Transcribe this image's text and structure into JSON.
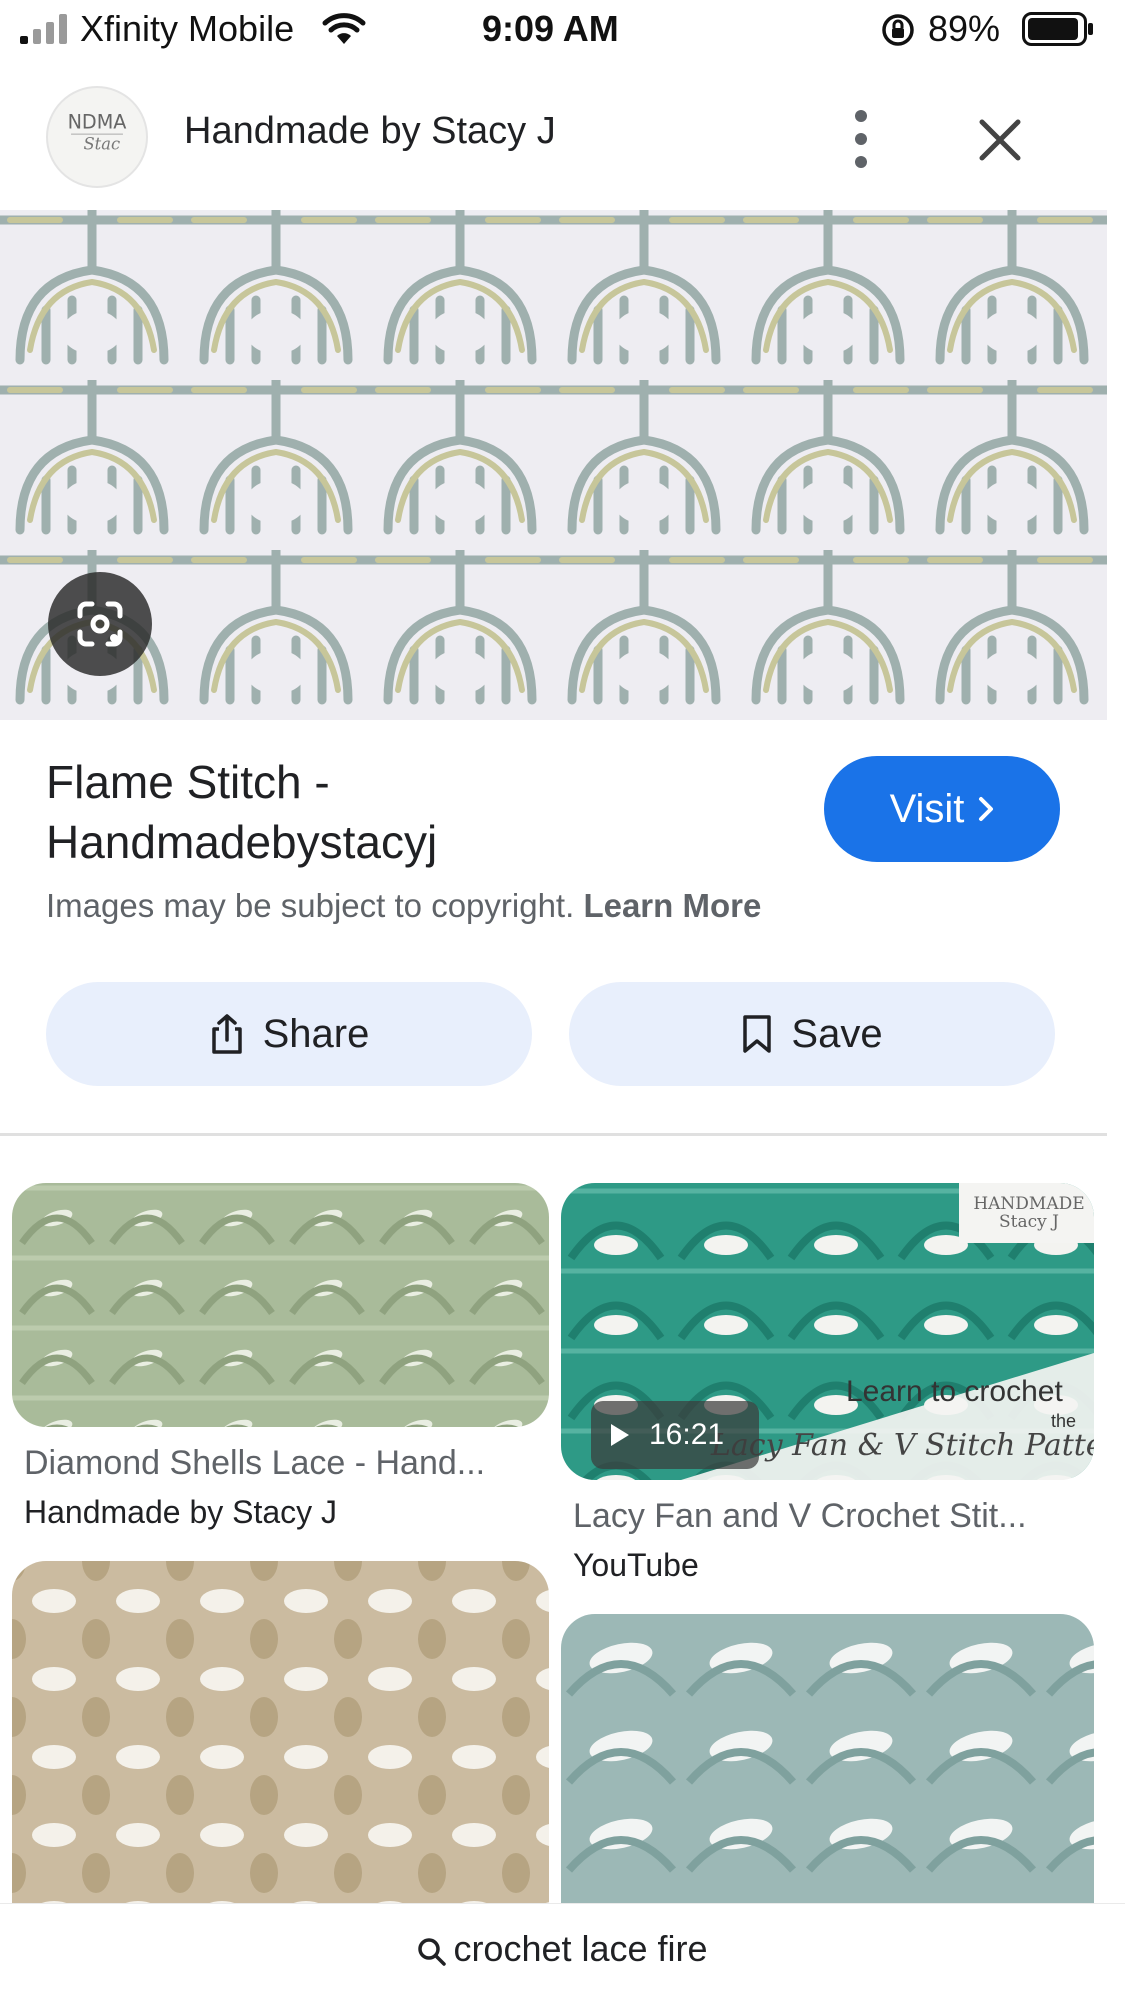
{
  "status_bar": {
    "carrier": "Xfinity Mobile",
    "time": "9:09 AM",
    "battery_percent": "89%"
  },
  "header": {
    "title": "Handmade by Stacy J",
    "avatar_logo_text": "NDMA Stac"
  },
  "hero": {
    "lens_icon": "google-lens-icon"
  },
  "result": {
    "title_line1": "Flame Stitch -",
    "title_line2": "Handmadebystacyj",
    "visit_label": "Visit",
    "copyright_text": "Images may be subject to copyright.",
    "learn_more": "Learn More"
  },
  "actions": {
    "share_label": "Share",
    "save_label": "Save"
  },
  "grid": {
    "items": [
      {
        "title": "Diamond Shells Lace - Hand...",
        "source": "Handmade by Stacy J",
        "color": "#a9bb9a"
      },
      {
        "title": "Lacy Fan and V Crochet Stit...",
        "source": "YouTube",
        "color": "#2e9a86",
        "duration": "16:21",
        "overlay_line1": "Learn to crochet",
        "overlay_the": "the",
        "overlay_line2": "Lacy Fan & V Stitch Pattern",
        "watermark": "HANDMADE Stacy J"
      },
      {
        "title": "",
        "source": "",
        "color": "#cbbba0"
      },
      {
        "title": "",
        "source": "",
        "color": "#9cb8b6"
      }
    ]
  },
  "bottom": {
    "query": "crochet lace fire"
  }
}
